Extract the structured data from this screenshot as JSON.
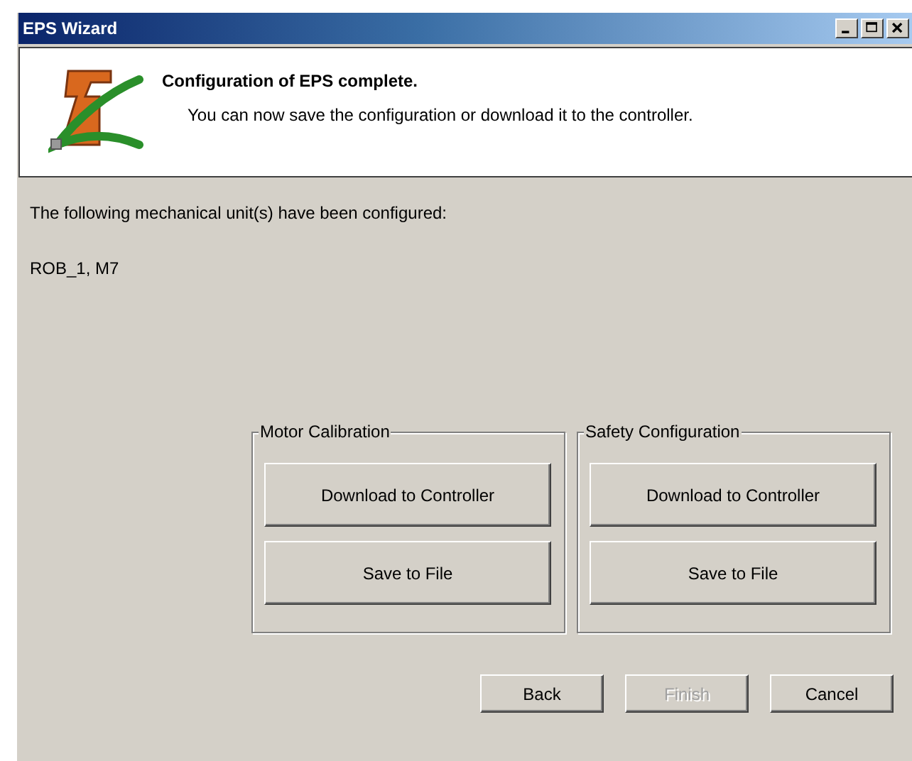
{
  "window": {
    "title": "EPS Wizard"
  },
  "header": {
    "title": "Configuration of EPS complete.",
    "subtitle": "You can now save the configuration or download it to the controller."
  },
  "intro": "The following mechanical unit(s) have been configured:",
  "units": "ROB_1, M7",
  "groups": [
    {
      "title": "Motor Calibration",
      "buttons": [
        {
          "label": "Download to Controller"
        },
        {
          "label": "Save to File"
        }
      ]
    },
    {
      "title": "Safety Configuration",
      "buttons": [
        {
          "label": "Download to Controller"
        },
        {
          "label": "Save to File"
        }
      ]
    }
  ],
  "buttons": [
    {
      "label": "Back",
      "disabled": false
    },
    {
      "label": "Finish",
      "disabled": true
    },
    {
      "label": "Cancel",
      "disabled": false
    }
  ]
}
